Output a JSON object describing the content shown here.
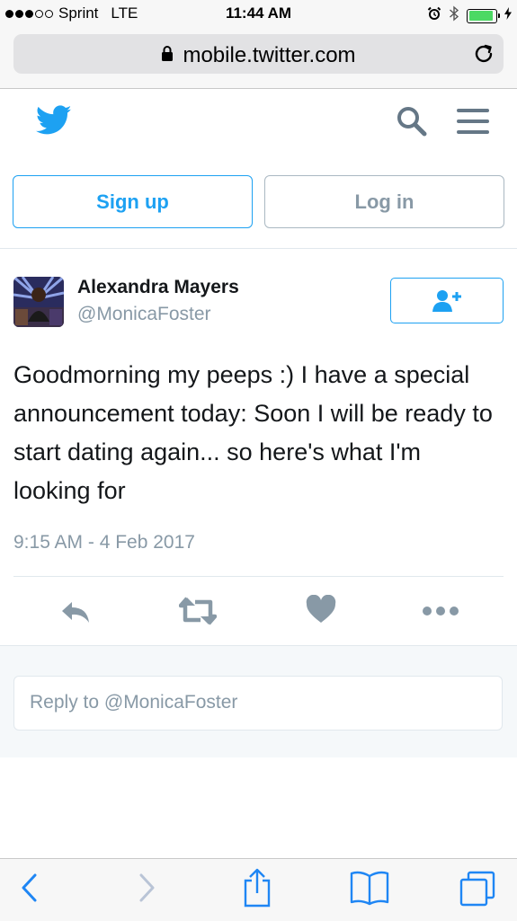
{
  "status_bar": {
    "carrier": "Sprint",
    "network": "LTE",
    "time": "11:44 AM",
    "signal_bars": 3,
    "signal_total": 5,
    "battery_level": 0.9,
    "battery_color": "#4cd964",
    "icons": [
      "alarm-clock-icon",
      "bluetooth-icon",
      "battery-icon",
      "charging-bolt-icon"
    ]
  },
  "browser": {
    "url": "mobile.twitter.com",
    "icons": [
      "lock-icon",
      "reload-icon"
    ]
  },
  "header": {
    "icons": [
      "twitter-bird-icon",
      "search-icon",
      "hamburger-menu-icon"
    ],
    "brand_color": "#1da1f2"
  },
  "auth": {
    "signup_label": "Sign up",
    "login_label": "Log in"
  },
  "tweet": {
    "author_name": "Alexandra Mayers",
    "author_handle": "@MonicaFoster",
    "text": "Goodmorning my peeps :) I have a special announcement today: Soon I will be ready to start dating again... so here's what I'm looking for",
    "timestamp": "9:15 AM - 4 Feb 2017",
    "follow_icon": "add-user-icon",
    "actions": [
      "reply-icon",
      "retweet-icon",
      "like-heart-icon",
      "more-icon"
    ]
  },
  "reply": {
    "placeholder": "Reply to @MonicaFoster"
  },
  "toolbar": {
    "icons": [
      "back-chevron-icon",
      "forward-chevron-icon",
      "share-icon",
      "bookmarks-icon",
      "tabs-icon"
    ]
  }
}
